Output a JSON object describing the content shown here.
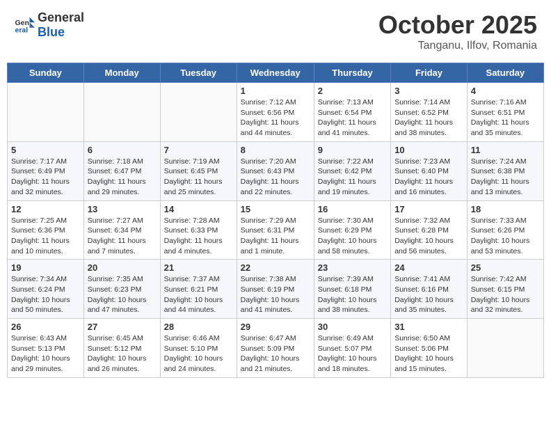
{
  "header": {
    "logo_general": "General",
    "logo_blue": "Blue",
    "month": "October 2025",
    "location": "Tanganu, Ilfov, Romania"
  },
  "weekdays": [
    "Sunday",
    "Monday",
    "Tuesday",
    "Wednesday",
    "Thursday",
    "Friday",
    "Saturday"
  ],
  "weeks": [
    [
      {
        "day": "",
        "info": ""
      },
      {
        "day": "",
        "info": ""
      },
      {
        "day": "",
        "info": ""
      },
      {
        "day": "1",
        "info": "Sunrise: 7:12 AM\nSunset: 6:56 PM\nDaylight: 11 hours and 44 minutes."
      },
      {
        "day": "2",
        "info": "Sunrise: 7:13 AM\nSunset: 6:54 PM\nDaylight: 11 hours and 41 minutes."
      },
      {
        "day": "3",
        "info": "Sunrise: 7:14 AM\nSunset: 6:52 PM\nDaylight: 11 hours and 38 minutes."
      },
      {
        "day": "4",
        "info": "Sunrise: 7:16 AM\nSunset: 6:51 PM\nDaylight: 11 hours and 35 minutes."
      }
    ],
    [
      {
        "day": "5",
        "info": "Sunrise: 7:17 AM\nSunset: 6:49 PM\nDaylight: 11 hours and 32 minutes."
      },
      {
        "day": "6",
        "info": "Sunrise: 7:18 AM\nSunset: 6:47 PM\nDaylight: 11 hours and 29 minutes."
      },
      {
        "day": "7",
        "info": "Sunrise: 7:19 AM\nSunset: 6:45 PM\nDaylight: 11 hours and 25 minutes."
      },
      {
        "day": "8",
        "info": "Sunrise: 7:20 AM\nSunset: 6:43 PM\nDaylight: 11 hours and 22 minutes."
      },
      {
        "day": "9",
        "info": "Sunrise: 7:22 AM\nSunset: 6:42 PM\nDaylight: 11 hours and 19 minutes."
      },
      {
        "day": "10",
        "info": "Sunrise: 7:23 AM\nSunset: 6:40 PM\nDaylight: 11 hours and 16 minutes."
      },
      {
        "day": "11",
        "info": "Sunrise: 7:24 AM\nSunset: 6:38 PM\nDaylight: 11 hours and 13 minutes."
      }
    ],
    [
      {
        "day": "12",
        "info": "Sunrise: 7:25 AM\nSunset: 6:36 PM\nDaylight: 11 hours and 10 minutes."
      },
      {
        "day": "13",
        "info": "Sunrise: 7:27 AM\nSunset: 6:34 PM\nDaylight: 11 hours and 7 minutes."
      },
      {
        "day": "14",
        "info": "Sunrise: 7:28 AM\nSunset: 6:33 PM\nDaylight: 11 hours and 4 minutes."
      },
      {
        "day": "15",
        "info": "Sunrise: 7:29 AM\nSunset: 6:31 PM\nDaylight: 11 hours and 1 minute."
      },
      {
        "day": "16",
        "info": "Sunrise: 7:30 AM\nSunset: 6:29 PM\nDaylight: 10 hours and 58 minutes."
      },
      {
        "day": "17",
        "info": "Sunrise: 7:32 AM\nSunset: 6:28 PM\nDaylight: 10 hours and 56 minutes."
      },
      {
        "day": "18",
        "info": "Sunrise: 7:33 AM\nSunset: 6:26 PM\nDaylight: 10 hours and 53 minutes."
      }
    ],
    [
      {
        "day": "19",
        "info": "Sunrise: 7:34 AM\nSunset: 6:24 PM\nDaylight: 10 hours and 50 minutes."
      },
      {
        "day": "20",
        "info": "Sunrise: 7:35 AM\nSunset: 6:23 PM\nDaylight: 10 hours and 47 minutes."
      },
      {
        "day": "21",
        "info": "Sunrise: 7:37 AM\nSunset: 6:21 PM\nDaylight: 10 hours and 44 minutes."
      },
      {
        "day": "22",
        "info": "Sunrise: 7:38 AM\nSunset: 6:19 PM\nDaylight: 10 hours and 41 minutes."
      },
      {
        "day": "23",
        "info": "Sunrise: 7:39 AM\nSunset: 6:18 PM\nDaylight: 10 hours and 38 minutes."
      },
      {
        "day": "24",
        "info": "Sunrise: 7:41 AM\nSunset: 6:16 PM\nDaylight: 10 hours and 35 minutes."
      },
      {
        "day": "25",
        "info": "Sunrise: 7:42 AM\nSunset: 6:15 PM\nDaylight: 10 hours and 32 minutes."
      }
    ],
    [
      {
        "day": "26",
        "info": "Sunrise: 6:43 AM\nSunset: 5:13 PM\nDaylight: 10 hours and 29 minutes."
      },
      {
        "day": "27",
        "info": "Sunrise: 6:45 AM\nSunset: 5:12 PM\nDaylight: 10 hours and 26 minutes."
      },
      {
        "day": "28",
        "info": "Sunrise: 6:46 AM\nSunset: 5:10 PM\nDaylight: 10 hours and 24 minutes."
      },
      {
        "day": "29",
        "info": "Sunrise: 6:47 AM\nSunset: 5:09 PM\nDaylight: 10 hours and 21 minutes."
      },
      {
        "day": "30",
        "info": "Sunrise: 6:49 AM\nSunset: 5:07 PM\nDaylight: 10 hours and 18 minutes."
      },
      {
        "day": "31",
        "info": "Sunrise: 6:50 AM\nSunset: 5:06 PM\nDaylight: 10 hours and 15 minutes."
      },
      {
        "day": "",
        "info": ""
      }
    ]
  ]
}
